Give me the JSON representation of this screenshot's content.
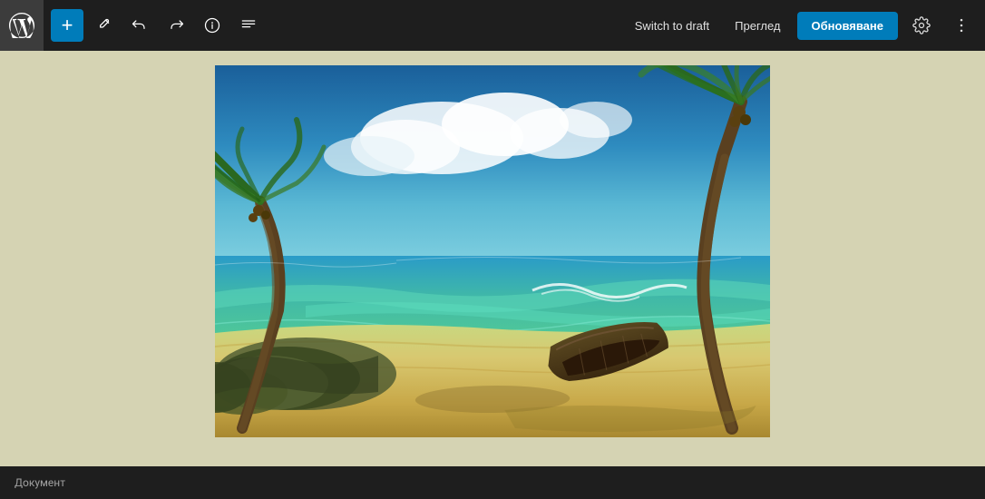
{
  "topbar": {
    "wp_logo_alt": "WordPress",
    "add_btn_label": "+",
    "switch_draft_label": "Switch to draft",
    "preview_label": "Преглед",
    "update_label": "Обновяване",
    "toolbar_items": [
      {
        "name": "edit",
        "symbol": "✏"
      },
      {
        "name": "undo",
        "symbol": "↩"
      },
      {
        "name": "redo",
        "symbol": "↪"
      },
      {
        "name": "info",
        "symbol": "ℹ"
      },
      {
        "name": "list",
        "symbol": "≡"
      }
    ]
  },
  "footer": {
    "label": "Документ"
  },
  "image": {
    "alt": "Beach painting with palm trees and a boat"
  }
}
